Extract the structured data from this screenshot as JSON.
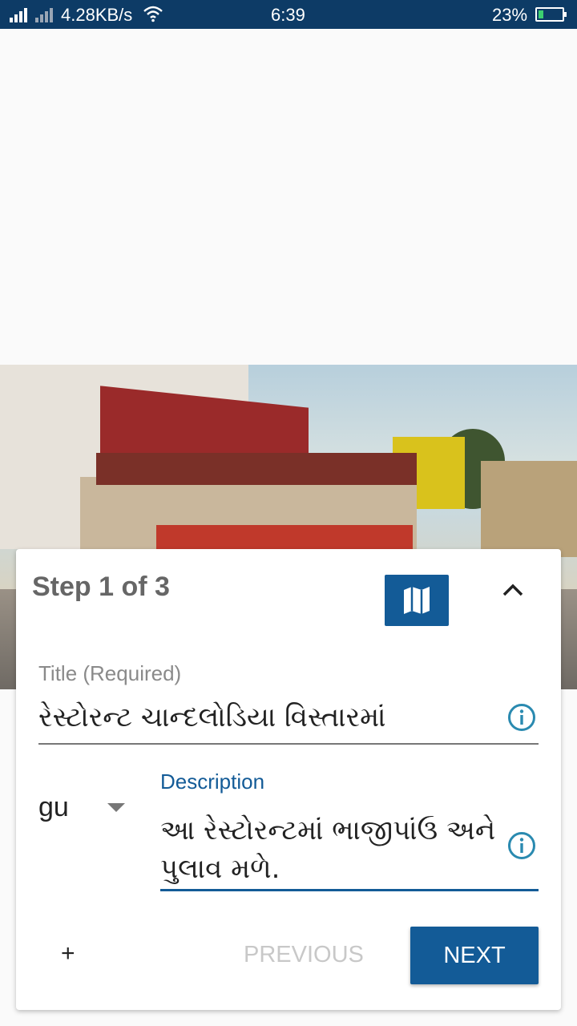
{
  "status_bar": {
    "net_speed": "4.28KB/s",
    "time": "6:39",
    "battery": "23%",
    "battery_level": 0.23
  },
  "card": {
    "step_title": "Step 1 of 3",
    "title_label": "Title (Required)",
    "title_value": "રેસ્ટોરન્ટ ચાન્દલોડિયા વિસ્તારમાં",
    "language": "gu",
    "description_label": "Description",
    "description_line1": "આ રેસ્ટોરન્ટમાં ભાજીપાંઉ અને",
    "description_line2": "પુલાવ મળે.",
    "plus_label": "+",
    "previous_label": "PREVIOUS",
    "next_label": "NEXT"
  },
  "colors": {
    "accent": "#135b97",
    "status_bar": "#0d3b66",
    "info_icon": "#2a8ab0"
  }
}
